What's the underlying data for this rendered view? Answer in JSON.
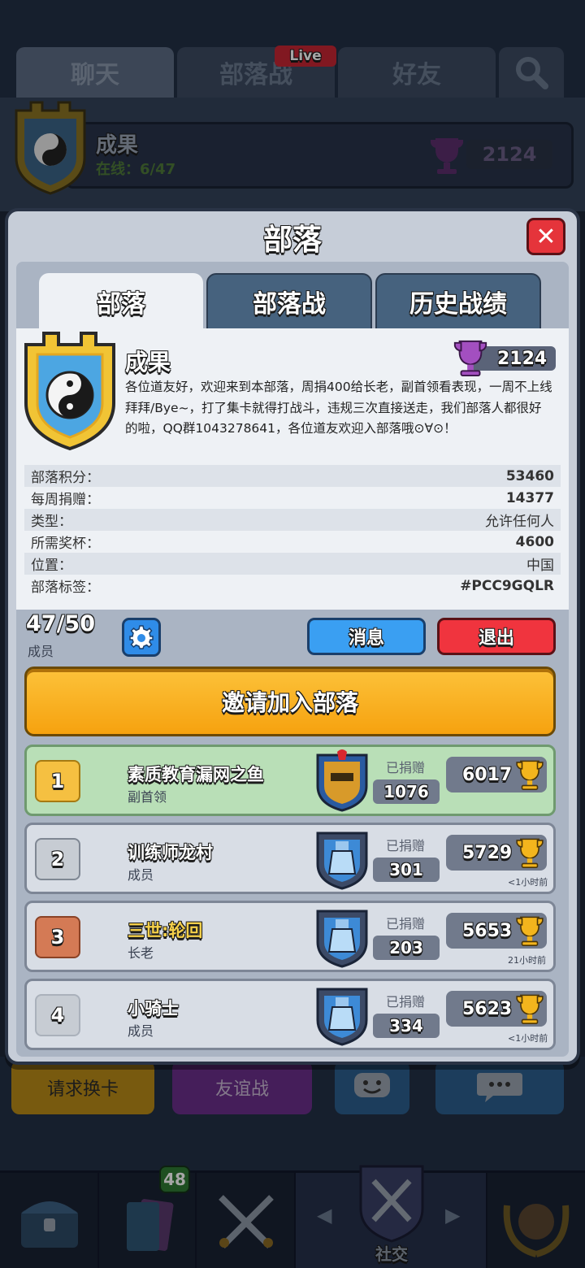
{
  "top_tabs": [
    {
      "label": "聊天"
    },
    {
      "label": "部落战",
      "badge": "Live"
    },
    {
      "label": "好友"
    }
  ],
  "header_clan": {
    "name": "成果",
    "online": "在线：6/47",
    "trophies": "2124"
  },
  "background_buttons": {
    "request_cards": "请求换卡",
    "friendly_battle": "友谊战"
  },
  "bottom_nav": {
    "shop_badge": "48",
    "active_label": "社交"
  },
  "modal": {
    "title": "部落",
    "tabs": [
      "部落",
      "部落战",
      "历史战绩"
    ],
    "clan": {
      "name": "成果",
      "trophies": "2124",
      "description": "各位道友好，欢迎来到本部落，周捐400给长老，副首领看表现，一周不上线拜拜/Bye~，打了集卡就得打战斗，违规三次直接送走，我们部落人都很好的啦，QQ群1043278641，各位道友欢迎入部落哦⊙∀⊙！"
    },
    "stats": [
      {
        "label": "部落积分：",
        "value": "53460"
      },
      {
        "label": "每周捐赠：",
        "value": "14377"
      },
      {
        "label": "类型：",
        "value": "允许任何人"
      },
      {
        "label": "所需奖杯：",
        "value": "4600"
      },
      {
        "label": "位置：",
        "value": "中国"
      },
      {
        "label": "部落标签：",
        "value": "#PCC9GQLR"
      }
    ],
    "members_count": "47/50",
    "members_label": "成员",
    "message_button": "消息",
    "leave_button": "退出",
    "invite_button": "邀请加入部落",
    "donated_label": "已捐赠",
    "members": [
      {
        "rank": "1",
        "name": "素质教育漏网之鱼",
        "role": "副首领",
        "donated": "1076",
        "trophies": "6017",
        "last_seen": ""
      },
      {
        "rank": "2",
        "name": "训练师龙村",
        "role": "成员",
        "donated": "301",
        "trophies": "5729",
        "last_seen": "<1小时前"
      },
      {
        "rank": "3",
        "name": "三世:轮回",
        "role": "长老",
        "donated": "203",
        "trophies": "5653",
        "last_seen": "21小时前"
      },
      {
        "rank": "4",
        "name": "小骑士",
        "role": "成员",
        "donated": "334",
        "trophies": "5623",
        "last_seen": "<1小时前"
      }
    ]
  },
  "colors": {
    "accent_gold": "#f6a20f",
    "leave_red": "#f0343e",
    "message_blue": "#3a9ff2",
    "trophy_purple": "#8b3fa0"
  }
}
